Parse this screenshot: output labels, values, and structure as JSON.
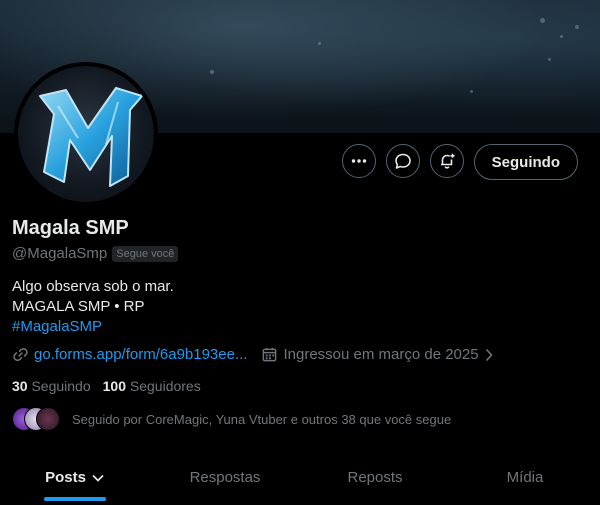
{
  "profile": {
    "name": "Magala SMP",
    "handle": "@MagalaSmp",
    "follows_you": "Segue você",
    "bio_line1": "Algo observa sob o mar.",
    "bio_line2": "MAGALA SMP • RP",
    "bio_hashtag": "#MagalaSMP",
    "link": "go.forms.app/form/6a9b193ee...",
    "joined": "Ingressou em março de 2025",
    "following_count": "30",
    "following_label": "Seguindo",
    "followers_count": "100",
    "followers_label": "Seguidores",
    "followed_by": "Seguido por CoreMagic, Yuna Vtuber e outros 38 que você segue",
    "avatar_letter": "M"
  },
  "actions": {
    "more_icon": "more-icon",
    "message_icon": "message-icon",
    "notify_icon": "notification-bell-icon",
    "follow_label": "Seguindo"
  },
  "tabs": [
    {
      "label": "Posts"
    },
    {
      "label": "Respostas"
    },
    {
      "label": "Reposts"
    },
    {
      "label": "Mídia"
    }
  ],
  "colors": {
    "accent": "#1d9bf0",
    "muted": "#71767b",
    "background": "#000000"
  }
}
